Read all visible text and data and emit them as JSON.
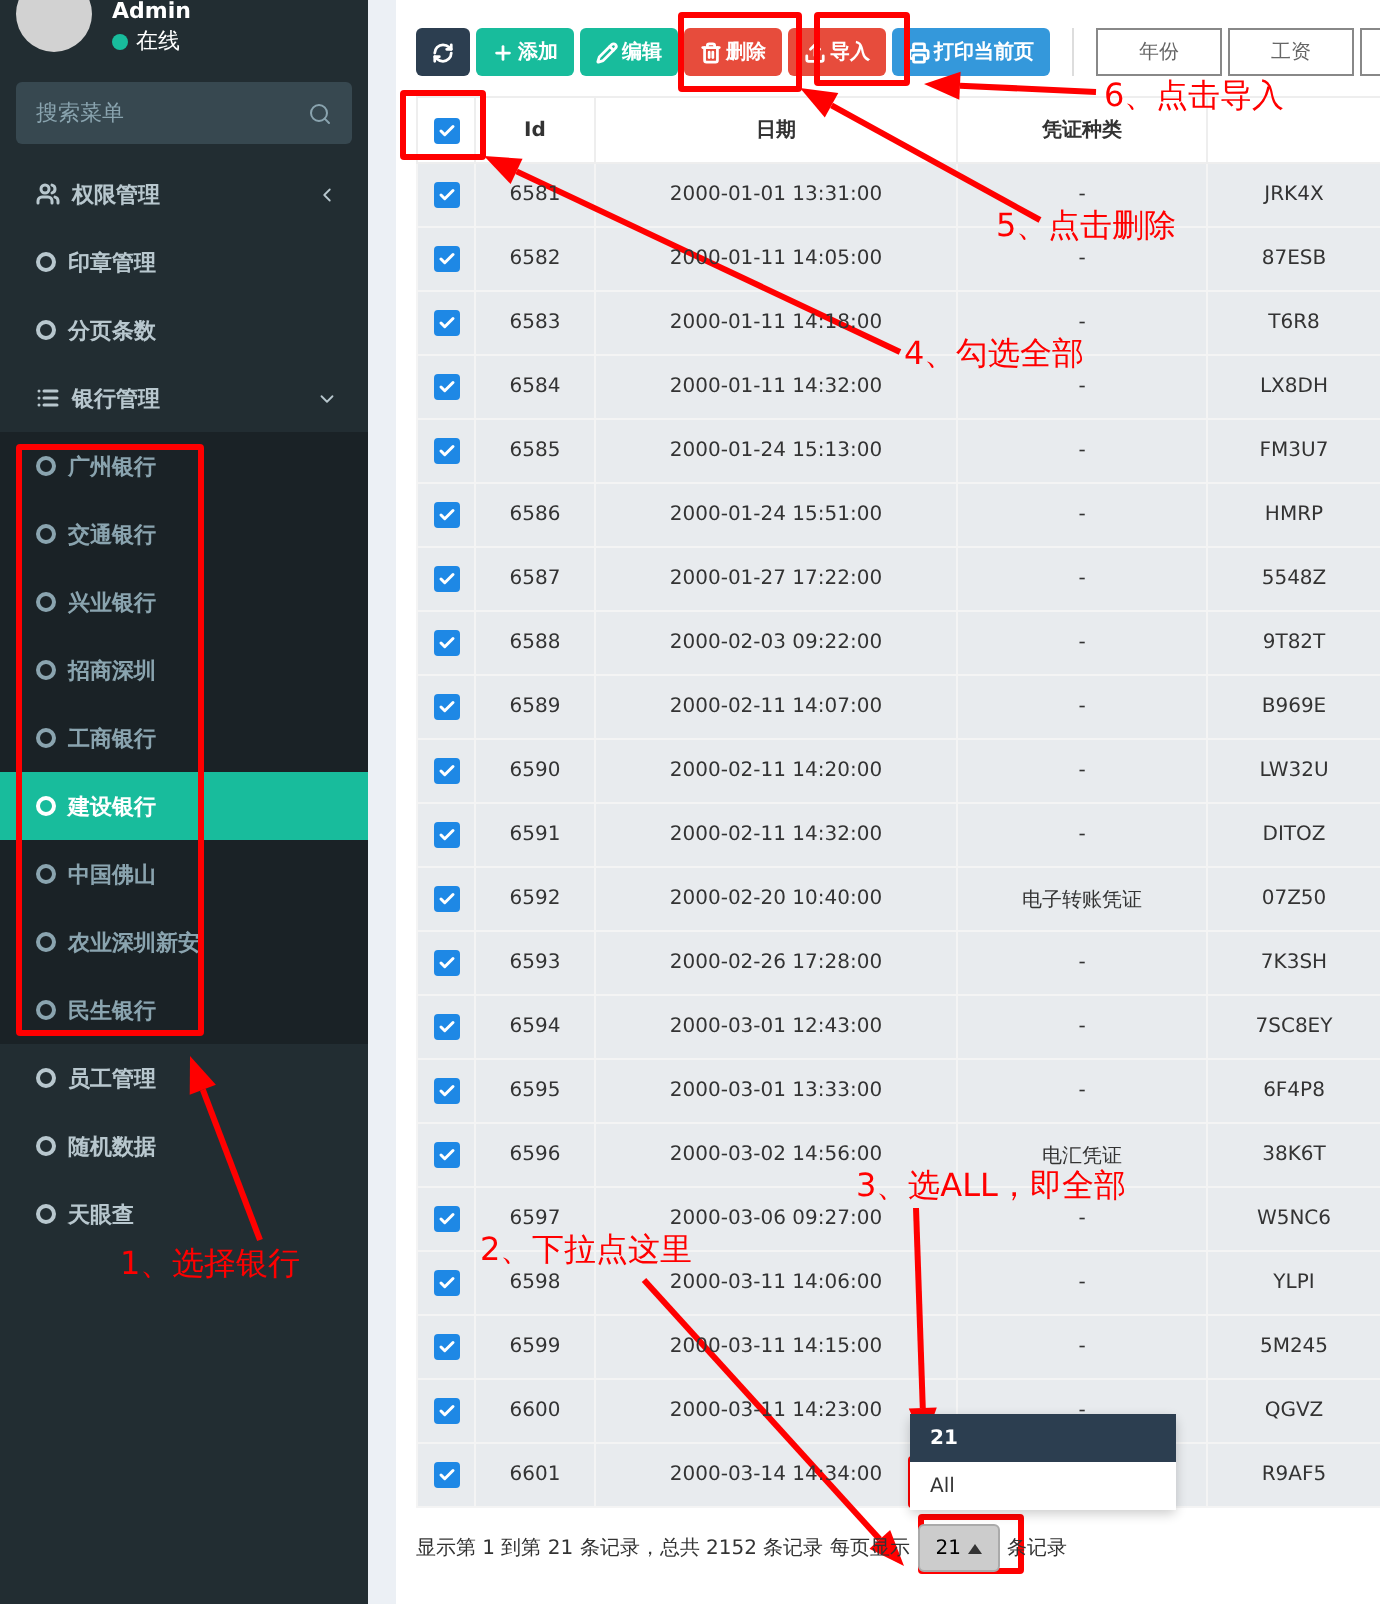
{
  "user": {
    "name": "Admin",
    "status": "在线"
  },
  "sidebar": {
    "search_placeholder": "搜索菜单",
    "items": [
      {
        "label": "权限管理",
        "kind": "group",
        "expanded": false
      },
      {
        "label": "印章管理",
        "kind": "link",
        "selected": false
      },
      {
        "label": "分页条数",
        "kind": "link",
        "selected": false
      },
      {
        "label": "银行管理",
        "kind": "group",
        "expanded": true,
        "children": [
          {
            "label": "广州银行",
            "selected": false
          },
          {
            "label": "交通银行",
            "selected": false
          },
          {
            "label": "兴业银行",
            "selected": false
          },
          {
            "label": "招商深圳",
            "selected": false
          },
          {
            "label": "工商银行",
            "selected": false
          },
          {
            "label": "建设银行",
            "selected": true
          },
          {
            "label": "中国佛山",
            "selected": false
          },
          {
            "label": "农业深圳新安",
            "selected": false
          },
          {
            "label": "民生银行",
            "selected": false
          }
        ]
      },
      {
        "label": "员工管理",
        "kind": "link",
        "selected": false
      },
      {
        "label": "随机数据",
        "kind": "link",
        "selected": false
      },
      {
        "label": "天眼查",
        "kind": "link",
        "selected": false
      }
    ]
  },
  "toolbar": {
    "buttons": [
      {
        "kind": "dark"
      },
      {
        "label": "添加",
        "kind": "success"
      },
      {
        "label": "编辑",
        "kind": "success"
      },
      {
        "label": "删除",
        "kind": "danger"
      },
      {
        "label": "导入",
        "kind": "danger"
      },
      {
        "label": "打印当前页",
        "kind": "info"
      }
    ],
    "filters": [
      "年份",
      "工资"
    ]
  },
  "table": {
    "select_all_checked": true,
    "columns": [
      "Id",
      "日期",
      "凭证种类"
    ],
    "rows": [
      {
        "checked": true,
        "id": "6581",
        "date": "2000-01-01 13:31:00",
        "type": "-",
        "column_4": "JRK4X"
      },
      {
        "checked": true,
        "id": "6582",
        "date": "2000-01-11 14:05:00",
        "type": "-",
        "column_4": "87ESB"
      },
      {
        "checked": true,
        "id": "6583",
        "date": "2000-01-11 14:18:00",
        "type": "-",
        "column_4": "T6R8"
      },
      {
        "checked": true,
        "id": "6584",
        "date": "2000-01-11 14:32:00",
        "type": "-",
        "column_4": "LX8DH"
      },
      {
        "checked": true,
        "id": "6585",
        "date": "2000-01-24 15:13:00",
        "type": "-",
        "column_4": "FM3U7"
      },
      {
        "checked": true,
        "id": "6586",
        "date": "2000-01-24 15:51:00",
        "type": "-",
        "column_4": "HMRP"
      },
      {
        "checked": true,
        "id": "6587",
        "date": "2000-01-27 17:22:00",
        "type": "-",
        "column_4": "5548Z"
      },
      {
        "checked": true,
        "id": "6588",
        "date": "2000-02-03 09:22:00",
        "type": "-",
        "column_4": "9T82T"
      },
      {
        "checked": true,
        "id": "6589",
        "date": "2000-02-11 14:07:00",
        "type": "-",
        "column_4": "B969E"
      },
      {
        "checked": true,
        "id": "6590",
        "date": "2000-02-11 14:20:00",
        "type": "-",
        "column_4": "LW32U"
      },
      {
        "checked": true,
        "id": "6591",
        "date": "2000-02-11 14:32:00",
        "type": "-",
        "column_4": "DITOZ"
      },
      {
        "checked": true,
        "id": "6592",
        "date": "2000-02-20 10:40:00",
        "type": "电子转账凭证",
        "column_4": "07Z50"
      },
      {
        "checked": true,
        "id": "6593",
        "date": "2000-02-26 17:28:00",
        "type": "-",
        "column_4": "7K3SH"
      },
      {
        "checked": true,
        "id": "6594",
        "date": "2000-03-01 12:43:00",
        "type": "-",
        "column_4": "7SC8EY"
      },
      {
        "checked": true,
        "id": "6595",
        "date": "2000-03-01 13:33:00",
        "type": "-",
        "column_4": "6F4P8"
      },
      {
        "checked": true,
        "id": "6596",
        "date": "2000-03-02 14:56:00",
        "type": "电汇凭证",
        "column_4": "38K6T"
      },
      {
        "checked": true,
        "id": "6597",
        "date": "2000-03-06 09:27:00",
        "type": "-",
        "column_4": "W5NC6"
      },
      {
        "checked": true,
        "id": "6598",
        "date": "2000-03-11 14:06:00",
        "type": "-",
        "column_4": "YLPI"
      },
      {
        "checked": true,
        "id": "6599",
        "date": "2000-03-11 14:15:00",
        "type": "-",
        "column_4": "5M245"
      },
      {
        "checked": true,
        "id": "6600",
        "date": "2000-03-11 14:23:00",
        "type": "-",
        "column_4": "QGVZ"
      },
      {
        "checked": true,
        "id": "6601",
        "date": "2000-03-14 14:34:00",
        "column_4": "R9AF5"
      }
    ]
  },
  "pagination": {
    "summary": "显示第 1 到第 21 条记录，总共 2152 条记录 每页显示",
    "page_size": "21",
    "suffix": "条记录",
    "page_size_options": [
      {
        "label": "21",
        "selected": true
      },
      {
        "label": "All",
        "selected": false
      }
    ]
  },
  "annotations": [
    "6、点击导入",
    "5、点击删除",
    "4、勾选全部",
    "3、选ALL，即全部",
    "2、下拉点这里",
    "1、选择银行"
  ]
}
